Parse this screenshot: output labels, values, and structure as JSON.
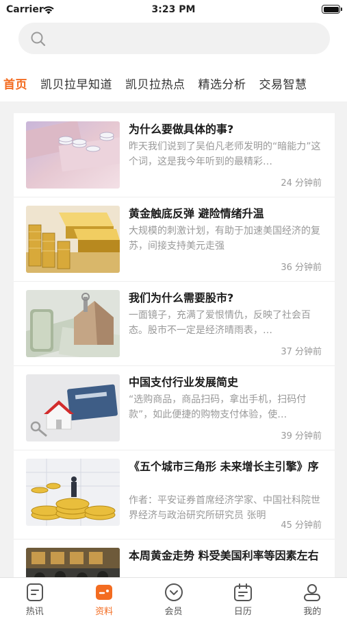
{
  "status_bar": {
    "carrier": "Carrier",
    "time": "3:23 PM"
  },
  "search": {
    "placeholder": ""
  },
  "tabs": [
    {
      "label": "首页",
      "active": true
    },
    {
      "label": "凯贝拉早知道",
      "active": false
    },
    {
      "label": "凯贝拉热点",
      "active": false
    },
    {
      "label": "精选分析",
      "active": false
    },
    {
      "label": "交易智慧",
      "active": false
    }
  ],
  "articles": [
    {
      "title": "为什么要做具体的事?",
      "summary": "昨天我们说到了吴伯凡老师发明的“暗能力”这个词，这是我今年听到的最精彩…",
      "time": "24 分钟前",
      "image_icon": "coins-on-banknotes-image"
    },
    {
      "title": "黄金触底反弹 避险情绪升温",
      "summary": "大规模的刺激计划，有助于加速美国经济的复苏，间接支持美元走强",
      "time": "36 分钟前",
      "image_icon": "gold-bars-image"
    },
    {
      "title": "我们为什么需要股市?",
      "summary": "一面镜子，充满了爱恨情仇，反映了社会百态。股市不一定是经济晴雨表，…",
      "time": "37 分钟前",
      "image_icon": "house-and-key-on-dollars-image"
    },
    {
      "title": "中国支付行业发展简史",
      "summary": "“选购商品，商品扫码，拿出手机，扫码付款”，如此便捷的购物支付体验，使…",
      "time": "39 分钟前",
      "image_icon": "house-model-with-keys-image"
    },
    {
      "title": "《五个城市三角形 未来增长主引擎》序",
      "summary": "作者：平安证券首席经济学家、中国社科院世界经济与政治研究所研究员 张明",
      "time": "45 分钟前",
      "image_icon": "businessman-on-gold-coins-image"
    },
    {
      "title": "本周黄金走势 料受美国利率等因素左右",
      "summary": "",
      "time": "",
      "image_icon": "trading-floor-image"
    }
  ],
  "nav": [
    {
      "label": "热讯",
      "icon": "news-icon",
      "active": false
    },
    {
      "label": "资料",
      "icon": "folder-icon",
      "active": true
    },
    {
      "label": "会员",
      "icon": "member-icon",
      "active": false
    },
    {
      "label": "日历",
      "icon": "calendar-icon",
      "active": false
    },
    {
      "label": "我的",
      "icon": "profile-icon",
      "active": false
    }
  ],
  "colors": {
    "accent": "#f36c21",
    "text_muted": "#999999",
    "background": "#f2f2f2"
  }
}
